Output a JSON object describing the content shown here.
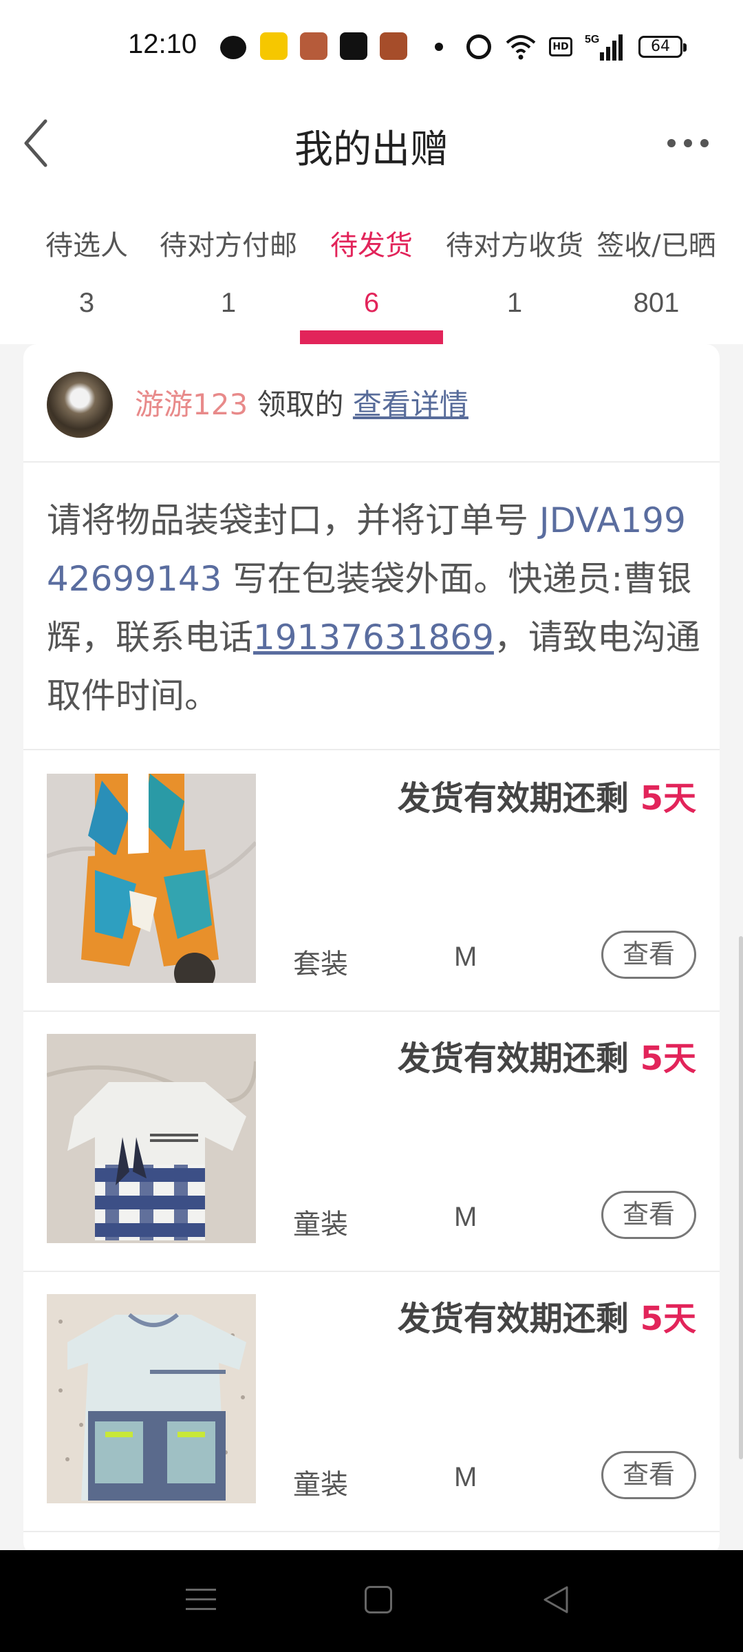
{
  "status_bar": {
    "time": "12:10",
    "hd_label": "HD",
    "network_label": "5G",
    "battery": "64",
    "icons": [
      "wechat-icon",
      "app-icon",
      "game-icon",
      "tiktok-icon",
      "game-icon",
      "dot-icon",
      "alarm-icon",
      "wifi-icon",
      "hd-icon",
      "signal-icon",
      "battery-icon"
    ]
  },
  "header": {
    "title": "我的出赠"
  },
  "tabs": [
    {
      "label": "待选人",
      "count": "3"
    },
    {
      "label": "待对方付邮",
      "count": "1"
    },
    {
      "label": "待发货",
      "count": "6"
    },
    {
      "label": "待对方收货",
      "count": "1"
    },
    {
      "label": "签收/已晒",
      "count": "801"
    }
  ],
  "active_tab_index": 2,
  "colors": {
    "accent": "#e2245a",
    "link": "#5a6d9f",
    "donor_name": "#e88a8a"
  },
  "donor": {
    "name": "游游123",
    "suffix": "领取的",
    "details_link": "查看详情"
  },
  "instruction": {
    "part1": "请将物品装袋封口，并将订单号 ",
    "order_number": "JDVA19942699143",
    "part2": " 写在包装袋外面。快递员:曹银辉，联系电话",
    "phone": "19137631869",
    "part3": "，请致电沟通取件时间。"
  },
  "items": [
    {
      "deadline_label": "发货有效期还剩 ",
      "days": "5天",
      "category": "套装",
      "size": "M",
      "view_label": "查看"
    },
    {
      "deadline_label": "发货有效期还剩 ",
      "days": "5天",
      "category": "童装",
      "size": "M",
      "view_label": "查看"
    },
    {
      "deadline_label": "发货有效期还剩 ",
      "days": "5天",
      "category": "童装",
      "size": "M",
      "view_label": "查看"
    }
  ]
}
